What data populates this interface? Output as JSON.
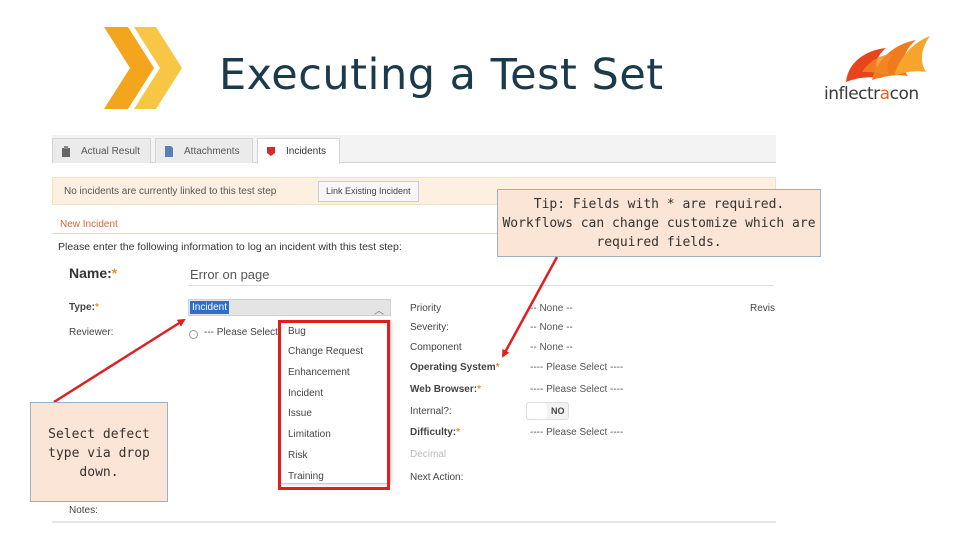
{
  "slide": {
    "title": "Executing a Test Set",
    "logo": {
      "part1": "inflectr",
      "part2": "a",
      "part3": "con"
    },
    "colors": {
      "chevron_dark": "#f2a51d",
      "chevron_light": "#f7c644",
      "title": "#1b3a4b",
      "accent": "#e8661c",
      "annotation_bg": "#fbe5d6",
      "highlight_red": "#e02020"
    }
  },
  "tabs": [
    {
      "label": "Actual Result",
      "icon": "clipboard-icon"
    },
    {
      "label": "Attachments",
      "icon": "document-icon"
    },
    {
      "label": "Incidents",
      "icon": "bug-icon"
    }
  ],
  "notice": {
    "text": "No incidents are currently linked to this test step",
    "button": "Link Existing Incident"
  },
  "form": {
    "section_title": "New Incident",
    "instructions": "Please enter the following information to log an incident with this test step:",
    "name_label": "Name:",
    "name_value": "Error on page",
    "type_label": "Type:",
    "type_value": "Incident",
    "reviewer_label": "Reviewer:",
    "reviewer_value": "--- Please Select",
    "notes_label": "Notes:",
    "type_options": [
      "Bug",
      "Change Request",
      "Enhancement",
      "Incident",
      "Issue",
      "Limitation",
      "Risk",
      "Training"
    ],
    "right_fields": [
      {
        "label": "Priority",
        "value": "-- None --"
      },
      {
        "label": "Severity:",
        "value": "-- None --"
      },
      {
        "label": "Component",
        "value": "-- None --"
      },
      {
        "label": "Operating System",
        "value": "---- Please Select ----"
      },
      {
        "label": "Web Browser:",
        "value": "---- Please Select ----"
      },
      {
        "label": "Internal?:",
        "value": "NO"
      },
      {
        "label": "Difficulty:",
        "value": "---- Please Select ----"
      },
      {
        "label": "",
        "value": "Decimal"
      },
      {
        "label": "Next Action:",
        "value": ""
      }
    ],
    "revision_label": "Revis"
  },
  "annotations": {
    "tip": "Tip: Fields with * are required. Workflows can change customize which are required fields.",
    "select_defect": "Select defect type via drop down."
  }
}
